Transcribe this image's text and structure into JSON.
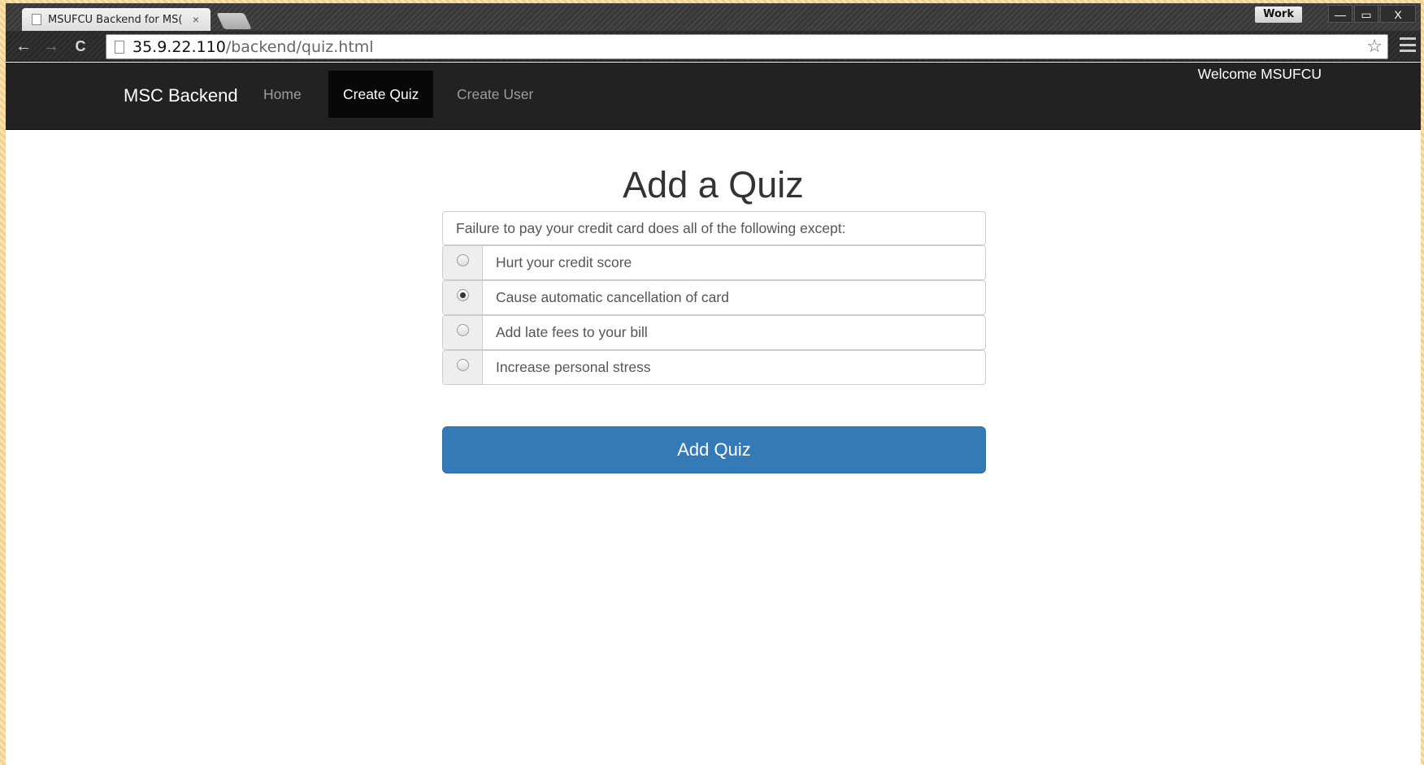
{
  "browser": {
    "tab_title": "MSUFCU Backend for MS(",
    "tab_close": "×",
    "profile": "Work",
    "window_minimize": "—",
    "window_restore": "▭",
    "window_close": "X",
    "back": "←",
    "forward": "→",
    "reload": "C",
    "url_host": "35.9.22.110",
    "url_path": "/backend/quiz.html",
    "bookmark_star": "☆"
  },
  "navbar": {
    "brand": "MSC Backend",
    "links": [
      {
        "label": "Home",
        "active": false
      },
      {
        "label": "Create Quiz",
        "active": true
      },
      {
        "label": "Create User",
        "active": false
      }
    ],
    "welcome": "Welcome MSUFCU"
  },
  "main": {
    "title": "Add a Quiz",
    "question": "Failure to pay your credit card does all of the following except:",
    "options": [
      {
        "label": "Hurt your credit score",
        "selected": false
      },
      {
        "label": "Cause automatic cancellation of card",
        "selected": true
      },
      {
        "label": "Add late fees to your bill",
        "selected": false
      },
      {
        "label": "Increase personal stress",
        "selected": false
      }
    ],
    "submit_label": "Add Quiz"
  },
  "colors": {
    "navbar_bg": "#222222",
    "active_link_bg": "#080808",
    "primary_button": "#337ab7"
  }
}
